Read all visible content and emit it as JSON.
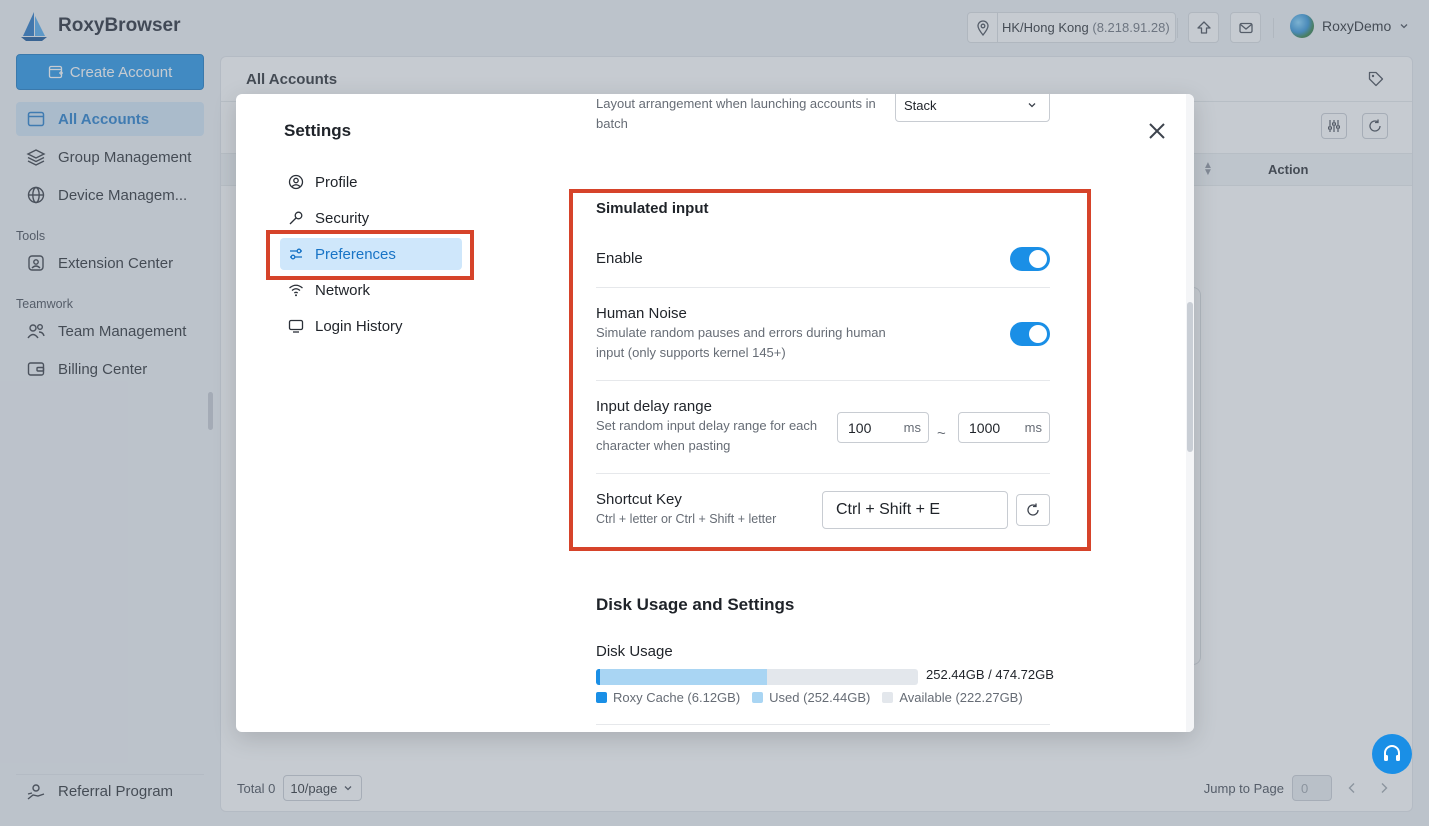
{
  "app": {
    "name": "RoxyBrowser"
  },
  "sidebar": {
    "create_label": "Create Account",
    "items": [
      {
        "label": "All Accounts"
      },
      {
        "label": "Group Management"
      },
      {
        "label": "Device Managem..."
      }
    ],
    "tools_label": "Tools",
    "tools_items": [
      {
        "label": "Extension Center"
      }
    ],
    "teamwork_label": "Teamwork",
    "teamwork_items": [
      {
        "label": "Team Management"
      },
      {
        "label": "Billing Center"
      }
    ],
    "referral_label": "Referral Program"
  },
  "topbar": {
    "location": "HK/Hong Kong",
    "ip": "(8.218.91.28)",
    "username": "RoxyDemo"
  },
  "main": {
    "title": "All Accounts",
    "action_col": "Action",
    "total_label": "Total 0",
    "page_size": "10/page",
    "jump_label": "Jump to Page",
    "jump_value": "0"
  },
  "settings": {
    "title": "Settings",
    "menu": [
      {
        "label": "Profile",
        "icon": "user-circle-icon"
      },
      {
        "label": "Security",
        "icon": "key-icon"
      },
      {
        "label": "Preferences",
        "icon": "sliders-icon",
        "active": true
      },
      {
        "label": "Network",
        "icon": "wifi-icon"
      },
      {
        "label": "Login History",
        "icon": "monitor-icon"
      }
    ],
    "layout_desc": "Layout arrangement when launching accounts in batch",
    "layout_value": "Stack",
    "simulated_input": {
      "heading": "Simulated input",
      "enable_label": "Enable",
      "enable_on": true,
      "noise_label": "Human Noise",
      "noise_desc": "Simulate random pauses and errors during human input (only supports kernel 145+)",
      "noise_on": true,
      "delay_label": "Input delay range",
      "delay_desc": "Set random input delay range for each character when pasting",
      "delay_min": "100",
      "delay_max": "1000",
      "delay_unit": "ms",
      "delay_sep": "~",
      "shortcut_label": "Shortcut Key",
      "shortcut_desc": "Ctrl + letter or Ctrl + Shift + letter",
      "shortcut_value": "Ctrl + Shift + E"
    },
    "disk": {
      "heading": "Disk Usage and Settings",
      "usage_label": "Disk Usage",
      "total_text": "252.44GB / 474.72GB",
      "used_fraction": 0.5318,
      "roxy_fraction": 0.0129,
      "legend_roxy": "Roxy Cache (6.12GB)",
      "legend_used": "Used (252.44GB)",
      "legend_available": "Available (222.27GB)"
    }
  },
  "colors": {
    "accent": "#1a8fe6",
    "highlight": "#d6432a",
    "used": "#a9d5f3",
    "available": "#e3e7ec"
  }
}
